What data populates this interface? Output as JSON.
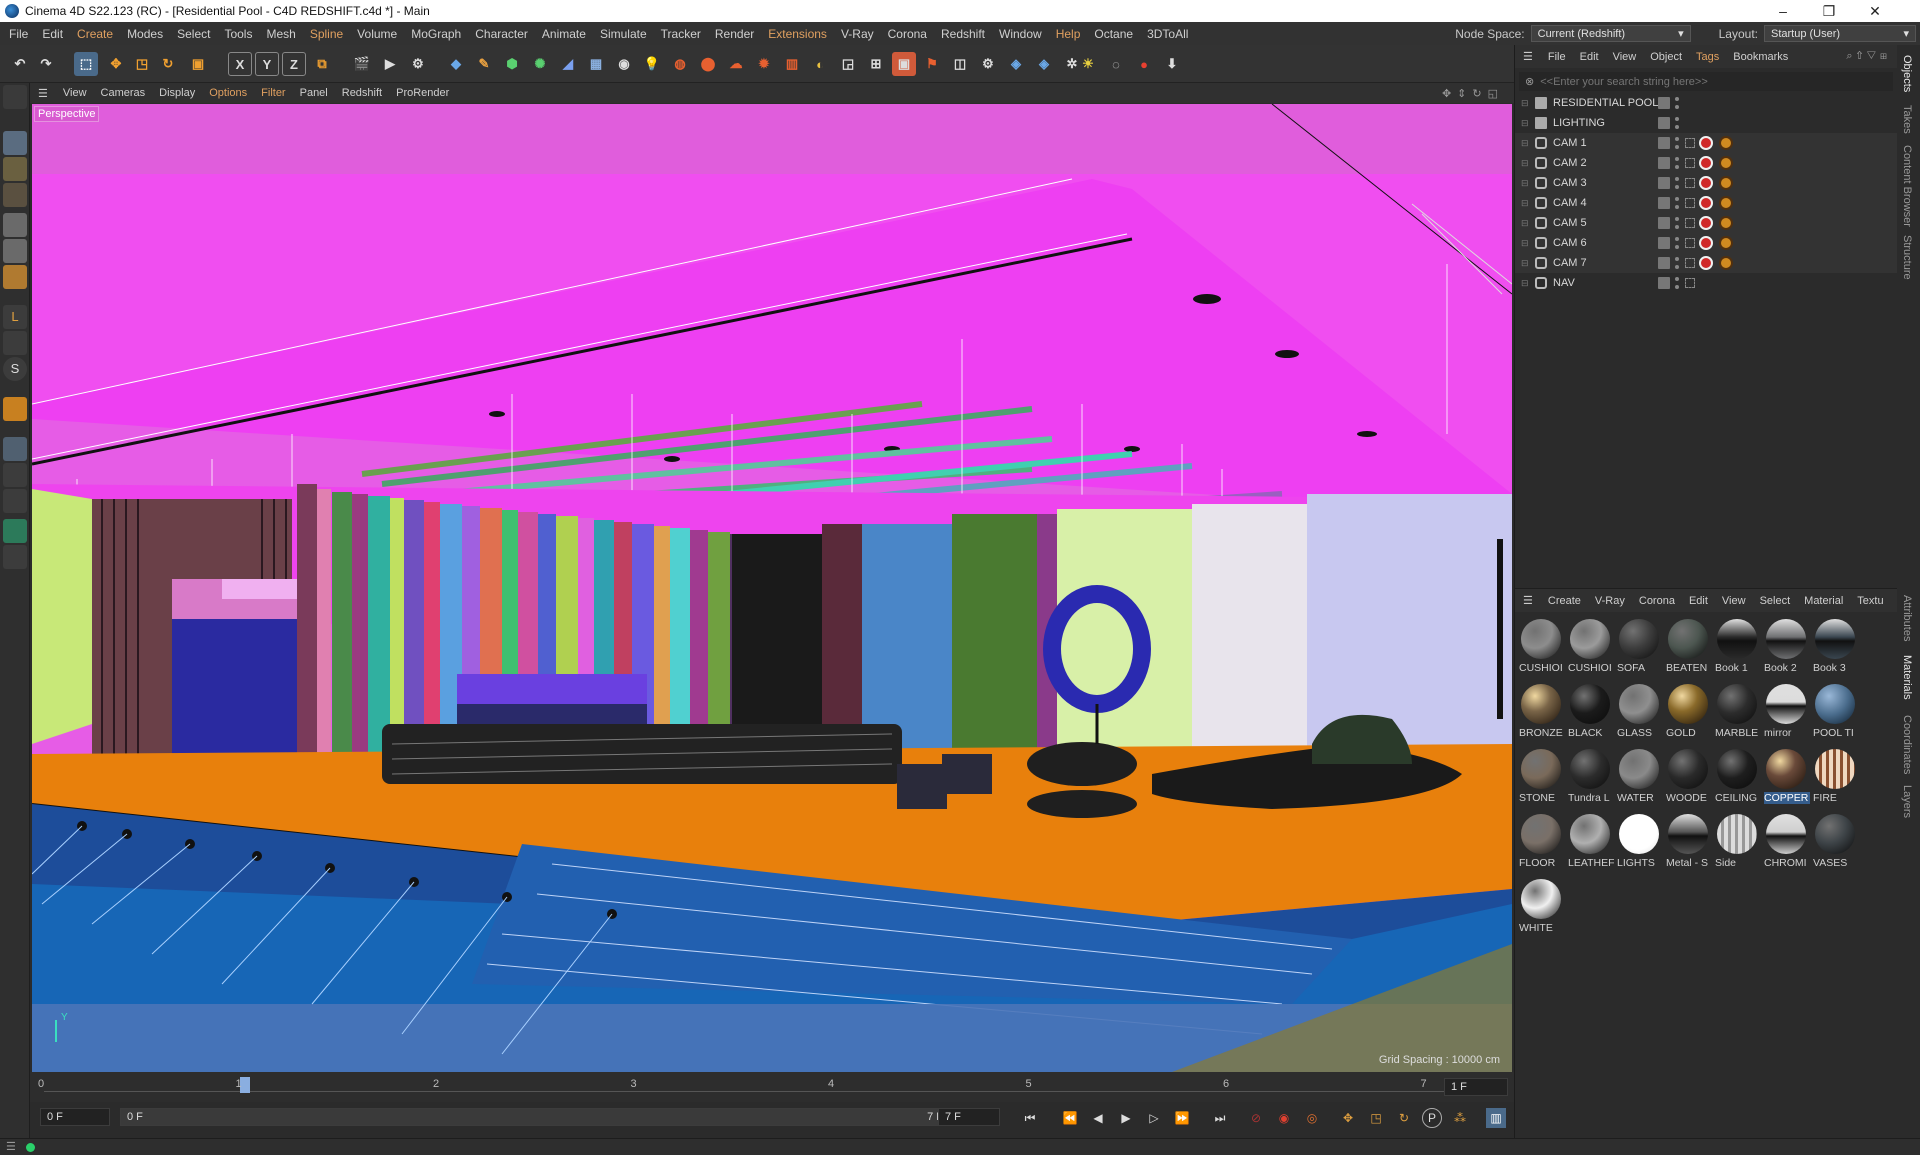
{
  "window": {
    "title": "Cinema 4D S22.123 (RC) - [Residential Pool - C4D REDSHIFT.c4d *] - Main",
    "min": "–",
    "max": "❐",
    "close": "✕"
  },
  "menubar": {
    "items": [
      "File",
      "Edit",
      "Create",
      "Modes",
      "Select",
      "Tools",
      "Mesh",
      "Spline",
      "Volume",
      "MoGraph",
      "Character",
      "Animate",
      "Simulate",
      "Tracker",
      "Render",
      "Extensions",
      "V-Ray",
      "Corona",
      "Redshift",
      "Window",
      "Help",
      "Octane",
      "3DToAll"
    ],
    "accent_items": [
      "Create",
      "Spline",
      "Extensions",
      "Help"
    ],
    "node_space_label": "Node Space:",
    "node_space_value": "Current (Redshift)",
    "layout_label": "Layout:",
    "layout_value": "Startup (User)"
  },
  "viewport_menu": {
    "items": [
      "View",
      "Cameras",
      "Display",
      "Options",
      "Filter",
      "Panel",
      "Redshift",
      "ProRender"
    ],
    "accent_items": [
      "Options",
      "Filter"
    ]
  },
  "viewport": {
    "label": "Perspective",
    "grid_spacing": "Grid Spacing : 10000 cm",
    "axis_label": "Y"
  },
  "object_manager": {
    "menu": [
      "File",
      "Edit",
      "View",
      "Object",
      "Tags",
      "Bookmarks"
    ],
    "accent_items": [
      "Tags"
    ],
    "search_placeholder": "<<Enter your search string here>>",
    "objects": [
      {
        "name": "RESIDENTIAL POOL",
        "type": "layer",
        "tags": 0
      },
      {
        "name": "LIGHTING",
        "type": "layer",
        "tags": 0
      },
      {
        "name": "CAM 1",
        "type": "camera",
        "tags": 2
      },
      {
        "name": "CAM 2",
        "type": "camera",
        "tags": 2
      },
      {
        "name": "CAM 3",
        "type": "camera",
        "tags": 2
      },
      {
        "name": "CAM 4",
        "type": "camera",
        "tags": 2
      },
      {
        "name": "CAM 5",
        "type": "camera",
        "tags": 2
      },
      {
        "name": "CAM 6",
        "type": "camera",
        "tags": 2
      },
      {
        "name": "CAM 7",
        "type": "camera",
        "tags": 2
      },
      {
        "name": "NAV",
        "type": "camera",
        "tags": 0
      }
    ]
  },
  "material_manager": {
    "menu": [
      "Create",
      "V-Ray",
      "Corona",
      "Edit",
      "View",
      "Select",
      "Material",
      "Textu"
    ],
    "materials": [
      {
        "name": "CUSHIOI",
        "color": "#8d8d8d",
        "style": "rough"
      },
      {
        "name": "CUSHIOI",
        "color": "#9b9b9b",
        "style": "rough"
      },
      {
        "name": "SOFA",
        "color": "#3d3d3d",
        "style": "matte"
      },
      {
        "name": "BEATEN",
        "color": "#4c5650",
        "style": "matte"
      },
      {
        "name": "Book 1",
        "color": "#2a2a2a",
        "style": "env"
      },
      {
        "name": "Book 2",
        "color": "#6f7072",
        "style": "env"
      },
      {
        "name": "Book 3",
        "color": "#3a4650",
        "style": "env"
      },
      {
        "name": "BRONZE",
        "color": "#7a6548",
        "style": "metal"
      },
      {
        "name": "BLACK",
        "color": "#1b1b1b",
        "style": "matte"
      },
      {
        "name": "GLASS",
        "color": "#8f8f8f",
        "style": "glass"
      },
      {
        "name": "GOLD",
        "color": "#8a6a2a",
        "style": "metal"
      },
      {
        "name": "MARBLE",
        "color": "#2c2c2c",
        "style": "matte"
      },
      {
        "name": "mirror",
        "color": "#dcdcdc",
        "style": "env"
      },
      {
        "name": "POOL TI",
        "color": "#4a6c8c",
        "style": "tile"
      },
      {
        "name": "STONE",
        "color": "#7a6a5a",
        "style": "rough"
      },
      {
        "name": "Tundra L",
        "color": "#2c2c2c",
        "style": "matte"
      },
      {
        "name": "WATER",
        "color": "#8a8a8a",
        "style": "glass"
      },
      {
        "name": "WOODE",
        "color": "#2a2a2a",
        "style": "matte"
      },
      {
        "name": "CEILING",
        "color": "#1e1e1e",
        "style": "matte"
      },
      {
        "name": "COPPER",
        "color": "#6a4a3a",
        "style": "metal",
        "selected": true
      },
      {
        "name": "FIRE",
        "color": "#c8a888",
        "style": "fire"
      },
      {
        "name": "FLOOR",
        "color": "#7a7068",
        "style": "rough"
      },
      {
        "name": "LEATHEF",
        "color": "#b0b0b0",
        "style": "shiny"
      },
      {
        "name": "LIGHTS",
        "color": "#ffffff",
        "style": "light"
      },
      {
        "name": "Metal - S",
        "color": "#555555",
        "style": "env"
      },
      {
        "name": "Side",
        "color": "#b0b0b0",
        "style": "stripe"
      },
      {
        "name": "CHROMI",
        "color": "#cfcfcf",
        "style": "env"
      },
      {
        "name": "VASES",
        "color": "#3e4448",
        "style": "matte"
      },
      {
        "name": "WHITE",
        "color": "#f0f0f0",
        "style": "shiny"
      }
    ]
  },
  "vertical_tabs": [
    {
      "label": "Objects",
      "active": true
    },
    {
      "label": "Takes",
      "active": false
    },
    {
      "label": "Content Browser",
      "active": false
    },
    {
      "label": "Structure",
      "active": false
    },
    {
      "label": "Attributes",
      "active": false
    },
    {
      "label": "Materials",
      "active": true
    },
    {
      "label": "Coordinates",
      "active": false
    },
    {
      "label": "Layers",
      "active": false
    }
  ],
  "timeline": {
    "ticks": [
      "0",
      "1",
      "2",
      "3",
      "4",
      "5",
      "6",
      "7"
    ],
    "current_frame_field": "1 F",
    "start_field": "0 F",
    "range_start": "0 F",
    "range_end": "7 F",
    "end_field": "7 F"
  }
}
